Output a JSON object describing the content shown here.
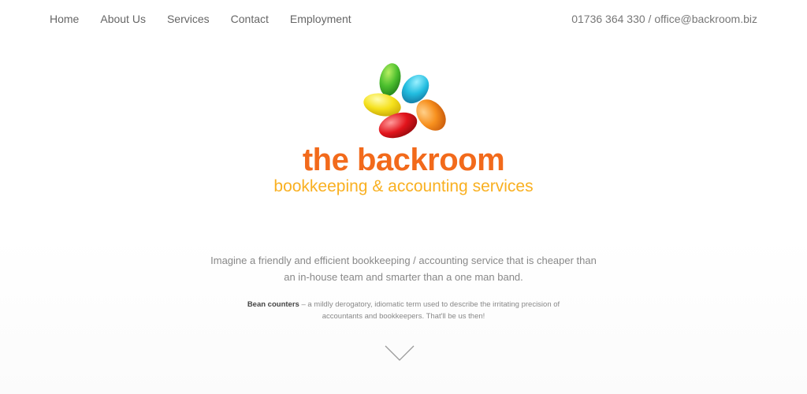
{
  "nav": {
    "items": [
      {
        "label": "Home"
      },
      {
        "label": "About Us"
      },
      {
        "label": "Services"
      },
      {
        "label": "Contact"
      },
      {
        "label": "Employment"
      }
    ]
  },
  "header": {
    "contact": "01736 364 330 / office@backroom.biz"
  },
  "logo": {
    "name": "the backroom",
    "tagline": "bookkeeping & accounting services",
    "icon": "jelly-beans-icon"
  },
  "intro": {
    "lead": "Imagine a friendly and efficient bookkeeping / accounting service that is cheaper than an in-house team and smarter than a one man band.",
    "term": "Bean counters",
    "definition": " – a mildly derogatory, idiomatic term used to describe the irritating precision of accountants and bookkeepers. That'll be us then!"
  },
  "colors": {
    "brand_orange": "#f26a1b",
    "brand_yellow": "#f9b021"
  },
  "scroll_icon": "chevron-down-icon"
}
